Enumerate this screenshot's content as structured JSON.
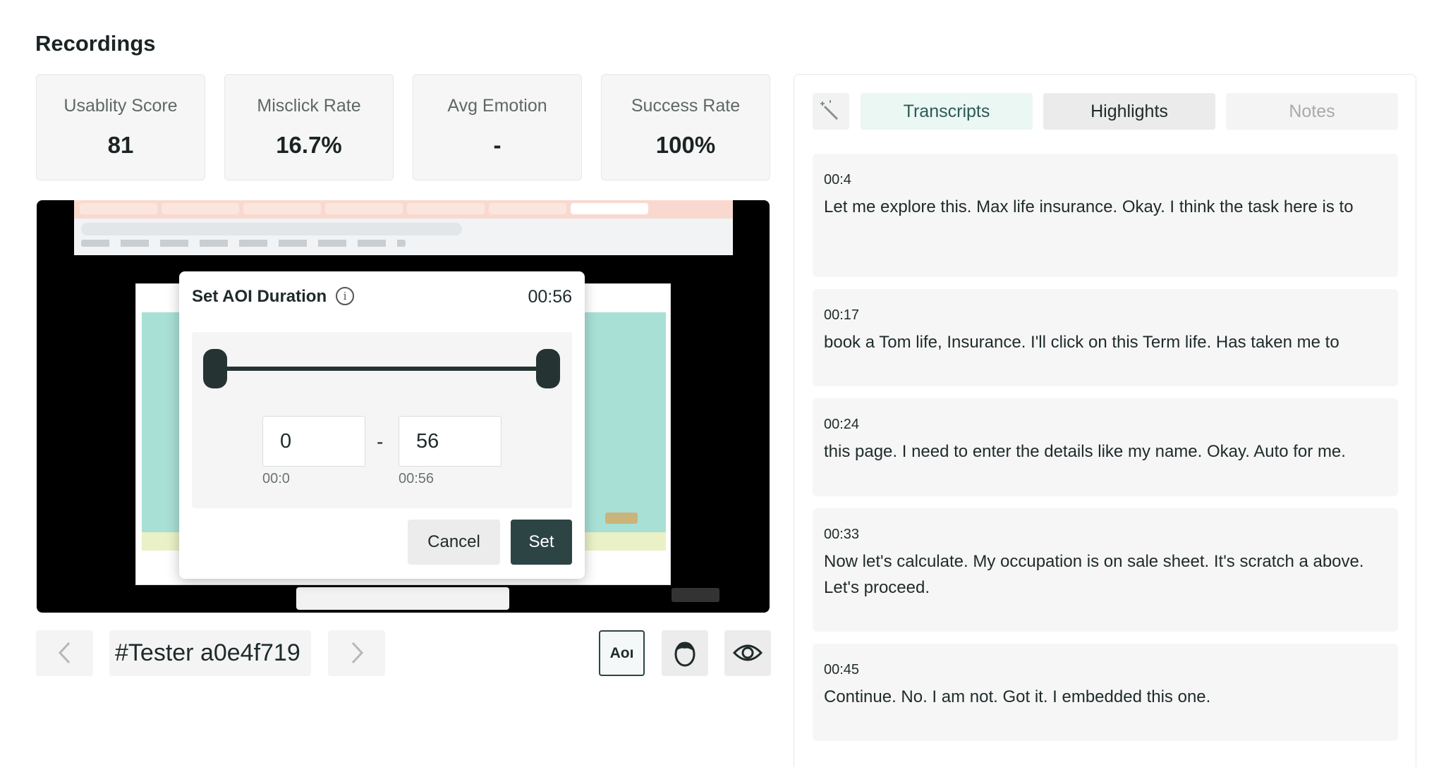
{
  "page": {
    "title": "Recordings"
  },
  "metrics": [
    {
      "label": "Usablity Score",
      "value": "81"
    },
    {
      "label": "Misclick Rate",
      "value": "16.7%"
    },
    {
      "label": "Avg Emotion",
      "value": "-"
    },
    {
      "label": "Success Rate",
      "value": "100%"
    }
  ],
  "aoi_modal": {
    "title": "Set AOI Duration",
    "time": "00:56",
    "start_value": "0",
    "end_value": "56",
    "separator": "-",
    "start_label": "00:0",
    "end_label": "00:56",
    "cancel_label": "Cancel",
    "set_label": "Set",
    "range_start_fraction": 0,
    "range_end_fraction": 1
  },
  "tester": {
    "id": "#Tester a0e4f719",
    "prev_icon": "chevron-left-icon",
    "next_icon": "chevron-right-icon"
  },
  "toolbar": {
    "aoi_label": "Aoı",
    "face_icon": "face-icon",
    "eye_icon": "eye-icon"
  },
  "tabs": [
    {
      "label": "Transcripts",
      "state": "active"
    },
    {
      "label": "Highlights",
      "state": "default"
    },
    {
      "label": "Notes",
      "state": "disabled"
    }
  ],
  "wand_icon": "magic-wand-icon",
  "transcripts": [
    {
      "time": "00:4",
      "text": "Let me explore this. Max life insurance. Okay. I think the task here is to"
    },
    {
      "time": "00:17",
      "text": "book a Tom life, Insurance. I'll click on this Term life. Has taken me to"
    },
    {
      "time": "00:24",
      "text": "this page. I need to enter the details like my name. Okay. Auto for me."
    },
    {
      "time": "00:33",
      "text": "Now let's calculate. My occupation is on sale sheet. It's scratch a above. Let's proceed."
    },
    {
      "time": "00:45",
      "text": "Continue. No. I am not. Got it. I embedded this one."
    }
  ],
  "colors": {
    "accent_dark": "#2d4444",
    "tab_active_bg": "#eaf7f3",
    "card_bg": "#f6f6f6"
  }
}
